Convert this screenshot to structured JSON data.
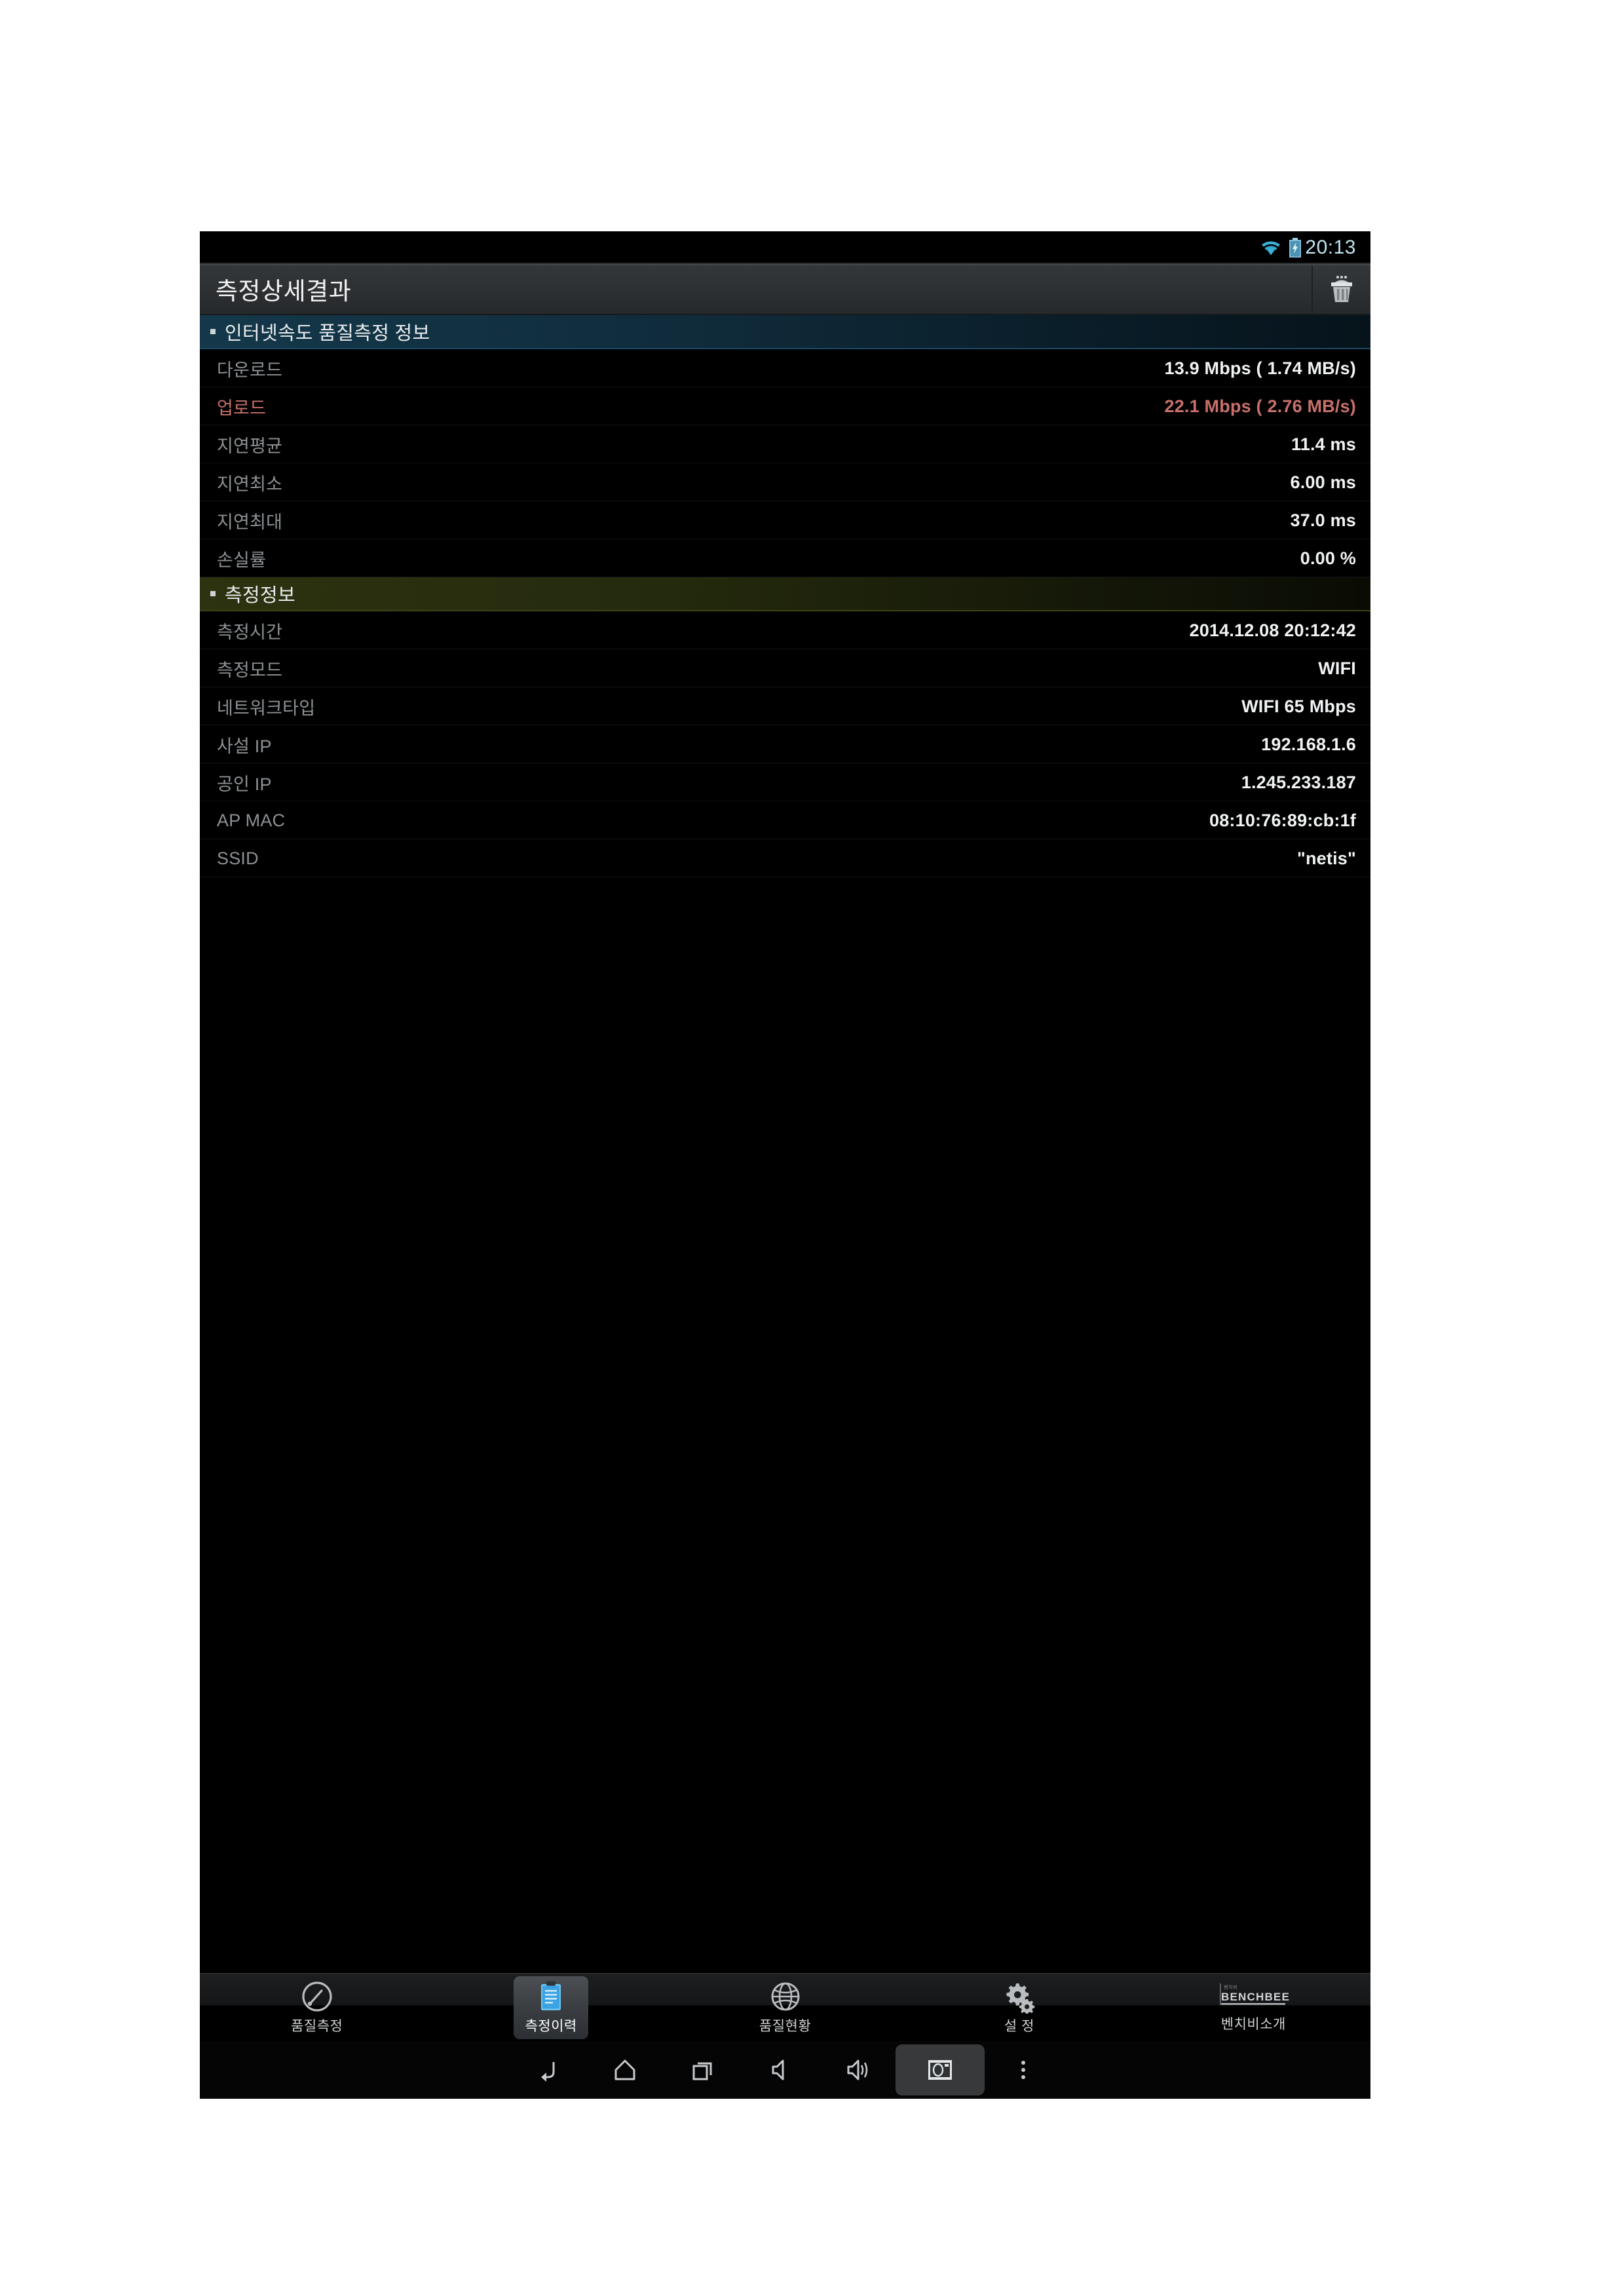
{
  "statusbar": {
    "wifi_icon": "wifi-icon",
    "battery_icon": "battery-charging-icon",
    "clock": "20:13"
  },
  "titlebar": {
    "title": "측정상세결과",
    "delete_icon": "trash-icon"
  },
  "sections": [
    {
      "id": "internet-speed-quality",
      "label": "인터넷속도 품질측정 정보",
      "accent": "#1b4a63",
      "rows": [
        {
          "key": "다운로드",
          "value": "13.9 Mbps ( 1.74 MB/s)",
          "accent": false
        },
        {
          "key": "업로드",
          "value": "22.1 Mbps ( 2.76 MB/s)",
          "accent": true
        },
        {
          "key": "지연평균",
          "value": "11.4 ms",
          "accent": false
        },
        {
          "key": "지연최소",
          "value": "6.00 ms",
          "accent": false
        },
        {
          "key": "지연최대",
          "value": "37.0 ms",
          "accent": false
        },
        {
          "key": "손실률",
          "value": "0.00 %",
          "accent": false
        }
      ]
    },
    {
      "id": "measurement-info",
      "label": "측정정보",
      "accent": "#3d4516",
      "rows": [
        {
          "key": "측정시간",
          "value": "2014.12.08 20:12:42",
          "accent": false
        },
        {
          "key": "측정모드",
          "value": "WIFI",
          "accent": false
        },
        {
          "key": "네트워크타입",
          "value": "WIFI 65 Mbps",
          "accent": false
        },
        {
          "key": "사설 IP",
          "value": "192.168.1.6",
          "accent": false
        },
        {
          "key": "공인 IP",
          "value": "1.245.233.187",
          "accent": false
        },
        {
          "key": "AP MAC",
          "value": "08:10:76:89:cb:1f",
          "accent": false
        },
        {
          "key": "SSID",
          "value": "\"netis\"",
          "accent": false
        }
      ]
    }
  ],
  "tabbar": {
    "tabs": [
      {
        "id": "quality-measure",
        "label": "품질측정",
        "icon": "speedometer-icon",
        "selected": false
      },
      {
        "id": "measure-history",
        "label": "측정이력",
        "icon": "clipboard-icon",
        "selected": true
      },
      {
        "id": "quality-status",
        "label": "품질현황",
        "icon": "globe-icon",
        "selected": false
      },
      {
        "id": "settings",
        "label": "설 정",
        "icon": "gears-icon",
        "selected": false
      },
      {
        "id": "about-benchbee",
        "label": "벤치비소개",
        "icon": "benchbee-logo-icon",
        "selected": false,
        "logo_text": "BENCHBEE",
        "logo_sub": "벤치비"
      }
    ]
  },
  "navbar": {
    "buttons": [
      {
        "id": "back",
        "icon": "back-arrow-icon",
        "highlight": false
      },
      {
        "id": "home",
        "icon": "home-icon",
        "highlight": false
      },
      {
        "id": "recents",
        "icon": "recents-icon",
        "highlight": false
      },
      {
        "id": "volume-down",
        "icon": "volume-down-icon",
        "highlight": false
      },
      {
        "id": "volume-up",
        "icon": "volume-up-icon",
        "highlight": false
      },
      {
        "id": "screenshot",
        "icon": "camera-icon",
        "highlight": true
      },
      {
        "id": "menu",
        "icon": "overflow-menu-icon",
        "highlight": false
      }
    ]
  },
  "colors": {
    "accent_red": "#c9706b",
    "accent_blue": "#1b4a63",
    "accent_olive": "#3d4516",
    "clock_blue": "#bfe4ef",
    "selected_tab_blue": "#3aa0e8"
  }
}
